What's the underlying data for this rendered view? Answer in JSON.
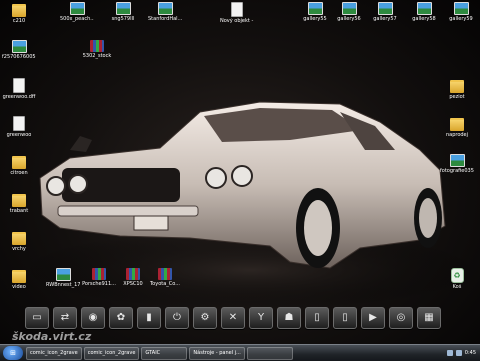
{
  "desktop": {
    "icons": [
      {
        "label": "c210",
        "type": "folder"
      },
      {
        "label": "500x_peach...",
        "type": "image"
      },
      {
        "label": "sng579Ill",
        "type": "image"
      },
      {
        "label": "StanfordHal...",
        "type": "image"
      },
      {
        "label": "Nový objekt - Textový d...",
        "type": "doc"
      },
      {
        "label": "gallery55",
        "type": "image"
      },
      {
        "label": "gallery56",
        "type": "image"
      },
      {
        "label": "gallery57",
        "type": "image"
      },
      {
        "label": "gallery58",
        "type": "image"
      },
      {
        "label": "gallery59",
        "type": "image"
      },
      {
        "label": "f2570676005...",
        "type": "image"
      },
      {
        "label": "5302_stock",
        "type": "rar"
      },
      {
        "label": "greenwoo.dff",
        "type": "doc"
      },
      {
        "label": "peziot",
        "type": "folder"
      },
      {
        "label": "greenwoo",
        "type": "doc"
      },
      {
        "label": "naprodej",
        "type": "folder"
      },
      {
        "label": "citroen",
        "type": "folder"
      },
      {
        "label": "fotografie0352",
        "type": "image"
      },
      {
        "label": "trabant",
        "type": "folder"
      },
      {
        "label": "vrchy",
        "type": "folder"
      },
      {
        "label": "video",
        "type": "folder"
      },
      {
        "label": "RWBnnest_174...",
        "type": "image"
      },
      {
        "label": "Porsche911...",
        "type": "rar"
      },
      {
        "label": "XPSC10",
        "type": "rar"
      },
      {
        "label": "Toyota_Co...",
        "type": "rar"
      },
      {
        "label": "Koš",
        "type": "recycle"
      }
    ]
  },
  "dock": {
    "buttons": [
      {
        "icon": "monitor-icon",
        "glyph": "▭"
      },
      {
        "icon": "network-icon",
        "glyph": "⇄"
      },
      {
        "icon": "disc-icon",
        "glyph": "◉"
      },
      {
        "icon": "knot-icon",
        "glyph": "✿"
      },
      {
        "icon": "battery-icon",
        "glyph": "▮"
      },
      {
        "icon": "power-icon",
        "glyph": "⏻"
      },
      {
        "icon": "settings-icon",
        "glyph": "⚙"
      },
      {
        "icon": "tools-icon",
        "glyph": "✕"
      },
      {
        "icon": "wrench-icon",
        "glyph": "Y"
      },
      {
        "icon": "people-icon",
        "glyph": "☗"
      },
      {
        "icon": "pages-icon",
        "glyph": "▯"
      },
      {
        "icon": "document-icon",
        "glyph": "▯"
      },
      {
        "icon": "play-icon",
        "glyph": "▶"
      },
      {
        "icon": "record-icon",
        "glyph": "◎"
      },
      {
        "icon": "image-icon",
        "glyph": "▦"
      }
    ]
  },
  "watermark": "škoda.virt.cz",
  "taskbar": {
    "start_label": "⊞",
    "tasks": [
      "comic_icon_2grave",
      "comic_icon_2grave",
      "GTAIC",
      "Nástroje - panel j...",
      ""
    ],
    "clock": "0:45"
  },
  "colors": {
    "background": "#000000",
    "folder": "#f2c14e",
    "taskbar": "#1f2328",
    "label": "#ffffff"
  }
}
